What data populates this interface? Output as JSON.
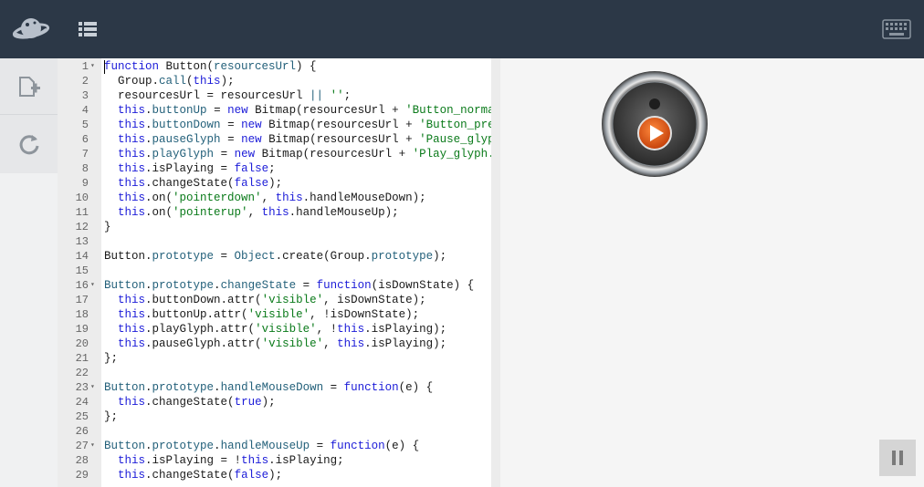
{
  "header": {
    "logo_icon": "planet-icon",
    "menu_icon": "list-icon",
    "keyboard_icon": "keyboard-icon",
    "bg_color": "#2c3847"
  },
  "sidebar": {
    "new_file_icon": "new-file-icon",
    "reload_icon": "refresh-icon"
  },
  "editor": {
    "lines": [
      {
        "n": "1",
        "fold": true,
        "tokens": [
          [
            "kw",
            "function"
          ],
          [
            "t",
            " Button("
          ],
          [
            "prop",
            "resourcesUrl"
          ],
          [
            "t",
            ") {"
          ]
        ]
      },
      {
        "n": "2",
        "fold": false,
        "tokens": [
          [
            "t",
            "  Group."
          ],
          [
            "prop",
            "call"
          ],
          [
            "t",
            "("
          ],
          [
            "kw",
            "this"
          ],
          [
            "t",
            ");"
          ]
        ]
      },
      {
        "n": "3",
        "fold": false,
        "tokens": [
          [
            "t",
            "  resourcesUrl = resourcesUrl "
          ],
          [
            "prop",
            "||"
          ],
          [
            "t",
            " "
          ],
          [
            "str",
            "''"
          ],
          [
            "t",
            ";"
          ]
        ]
      },
      {
        "n": "4",
        "fold": false,
        "tokens": [
          [
            "t",
            "  "
          ],
          [
            "kw",
            "this"
          ],
          [
            "t",
            "."
          ],
          [
            "prop",
            "buttonUp"
          ],
          [
            "t",
            " = "
          ],
          [
            "kw",
            "new"
          ],
          [
            "t",
            " Bitmap(resourcesUrl + "
          ],
          [
            "str",
            "'Button_normal.pr"
          ]
        ]
      },
      {
        "n": "5",
        "fold": false,
        "tokens": [
          [
            "t",
            "  "
          ],
          [
            "kw",
            "this"
          ],
          [
            "t",
            "."
          ],
          [
            "prop",
            "buttonDown"
          ],
          [
            "t",
            " = "
          ],
          [
            "kw",
            "new"
          ],
          [
            "t",
            " Bitmap(resourcesUrl + "
          ],
          [
            "str",
            "'Button_pressed"
          ]
        ]
      },
      {
        "n": "6",
        "fold": false,
        "tokens": [
          [
            "t",
            "  "
          ],
          [
            "kw",
            "this"
          ],
          [
            "t",
            "."
          ],
          [
            "prop",
            "pauseGlyph"
          ],
          [
            "t",
            " = "
          ],
          [
            "kw",
            "new"
          ],
          [
            "t",
            " Bitmap(resourcesUrl + "
          ],
          [
            "str",
            "'Pause_glyph.pr"
          ]
        ]
      },
      {
        "n": "7",
        "fold": false,
        "tokens": [
          [
            "t",
            "  "
          ],
          [
            "kw",
            "this"
          ],
          [
            "t",
            "."
          ],
          [
            "prop",
            "playGlyph"
          ],
          [
            "t",
            " = "
          ],
          [
            "kw",
            "new"
          ],
          [
            "t",
            " Bitmap(resourcesUrl + "
          ],
          [
            "str",
            "'Play_glyph.png'"
          ]
        ]
      },
      {
        "n": "8",
        "fold": false,
        "tokens": [
          [
            "t",
            "  "
          ],
          [
            "kw",
            "this"
          ],
          [
            "t",
            ".isPlaying = "
          ],
          [
            "kw",
            "false"
          ],
          [
            "t",
            ";"
          ]
        ]
      },
      {
        "n": "9",
        "fold": false,
        "tokens": [
          [
            "t",
            "  "
          ],
          [
            "kw",
            "this"
          ],
          [
            "t",
            ".changeState("
          ],
          [
            "kw",
            "false"
          ],
          [
            "t",
            ");"
          ]
        ]
      },
      {
        "n": "10",
        "fold": false,
        "tokens": [
          [
            "t",
            "  "
          ],
          [
            "kw",
            "this"
          ],
          [
            "t",
            ".on("
          ],
          [
            "str",
            "'pointerdown'"
          ],
          [
            "t",
            ", "
          ],
          [
            "kw",
            "this"
          ],
          [
            "t",
            ".handleMouseDown);"
          ]
        ]
      },
      {
        "n": "11",
        "fold": false,
        "tokens": [
          [
            "t",
            "  "
          ],
          [
            "kw",
            "this"
          ],
          [
            "t",
            ".on("
          ],
          [
            "str",
            "'pointerup'"
          ],
          [
            "t",
            ", "
          ],
          [
            "kw",
            "this"
          ],
          [
            "t",
            ".handleMouseUp);"
          ]
        ]
      },
      {
        "n": "12",
        "fold": false,
        "tokens": [
          [
            "t",
            "}"
          ]
        ]
      },
      {
        "n": "13",
        "fold": false,
        "tokens": [
          [
            "t",
            ""
          ]
        ]
      },
      {
        "n": "14",
        "fold": false,
        "tokens": [
          [
            "t",
            "Button."
          ],
          [
            "prop",
            "prototype"
          ],
          [
            "t",
            " = "
          ],
          [
            "prop",
            "Object"
          ],
          [
            "t",
            ".create(Group."
          ],
          [
            "prop",
            "prototype"
          ],
          [
            "t",
            ");"
          ]
        ]
      },
      {
        "n": "15",
        "fold": false,
        "tokens": [
          [
            "t",
            ""
          ]
        ]
      },
      {
        "n": "16",
        "fold": true,
        "tokens": [
          [
            "prop",
            "Button"
          ],
          [
            "t",
            "."
          ],
          [
            "prop",
            "prototype"
          ],
          [
            "t",
            "."
          ],
          [
            "prop",
            "changeState"
          ],
          [
            "t",
            " = "
          ],
          [
            "kw",
            "function"
          ],
          [
            "t",
            "(isDownState) {"
          ]
        ]
      },
      {
        "n": "17",
        "fold": false,
        "tokens": [
          [
            "t",
            "  "
          ],
          [
            "kw",
            "this"
          ],
          [
            "t",
            ".buttonDown.attr("
          ],
          [
            "str",
            "'visible'"
          ],
          [
            "t",
            ", isDownState);"
          ]
        ]
      },
      {
        "n": "18",
        "fold": false,
        "tokens": [
          [
            "t",
            "  "
          ],
          [
            "kw",
            "this"
          ],
          [
            "t",
            ".buttonUp.attr("
          ],
          [
            "str",
            "'visible'"
          ],
          [
            "t",
            ", !isDownState);"
          ]
        ]
      },
      {
        "n": "19",
        "fold": false,
        "tokens": [
          [
            "t",
            "  "
          ],
          [
            "kw",
            "this"
          ],
          [
            "t",
            ".playGlyph.attr("
          ],
          [
            "str",
            "'visible'"
          ],
          [
            "t",
            ", !"
          ],
          [
            "kw",
            "this"
          ],
          [
            "t",
            ".isPlaying);"
          ]
        ]
      },
      {
        "n": "20",
        "fold": false,
        "tokens": [
          [
            "t",
            "  "
          ],
          [
            "kw",
            "this"
          ],
          [
            "t",
            ".pauseGlyph.attr("
          ],
          [
            "str",
            "'visible'"
          ],
          [
            "t",
            ", "
          ],
          [
            "kw",
            "this"
          ],
          [
            "t",
            ".isPlaying);"
          ]
        ]
      },
      {
        "n": "21",
        "fold": false,
        "tokens": [
          [
            "t",
            "};"
          ]
        ]
      },
      {
        "n": "22",
        "fold": false,
        "tokens": [
          [
            "t",
            ""
          ]
        ]
      },
      {
        "n": "23",
        "fold": true,
        "tokens": [
          [
            "prop",
            "Button"
          ],
          [
            "t",
            "."
          ],
          [
            "prop",
            "prototype"
          ],
          [
            "t",
            "."
          ],
          [
            "prop",
            "handleMouseDown"
          ],
          [
            "t",
            " = "
          ],
          [
            "kw",
            "function"
          ],
          [
            "t",
            "(e) {"
          ]
        ]
      },
      {
        "n": "24",
        "fold": false,
        "tokens": [
          [
            "t",
            "  "
          ],
          [
            "kw",
            "this"
          ],
          [
            "t",
            ".changeState("
          ],
          [
            "kw",
            "true"
          ],
          [
            "t",
            ");"
          ]
        ]
      },
      {
        "n": "25",
        "fold": false,
        "tokens": [
          [
            "t",
            "};"
          ]
        ]
      },
      {
        "n": "26",
        "fold": false,
        "tokens": [
          [
            "t",
            ""
          ]
        ]
      },
      {
        "n": "27",
        "fold": true,
        "tokens": [
          [
            "prop",
            "Button"
          ],
          [
            "t",
            "."
          ],
          [
            "prop",
            "prototype"
          ],
          [
            "t",
            "."
          ],
          [
            "prop",
            "handleMouseUp"
          ],
          [
            "t",
            " = "
          ],
          [
            "kw",
            "function"
          ],
          [
            "t",
            "(e) {"
          ]
        ]
      },
      {
        "n": "28",
        "fold": false,
        "tokens": [
          [
            "t",
            "  "
          ],
          [
            "kw",
            "this"
          ],
          [
            "t",
            ".isPlaying = !"
          ],
          [
            "kw",
            "this"
          ],
          [
            "t",
            ".isPlaying;"
          ]
        ]
      },
      {
        "n": "29",
        "fold": false,
        "tokens": [
          [
            "t",
            "  "
          ],
          [
            "kw",
            "this"
          ],
          [
            "t",
            ".changeState("
          ],
          [
            "kw",
            "false"
          ],
          [
            "t",
            ");"
          ]
        ]
      }
    ]
  },
  "preview": {
    "player_icon": "play-button-icon",
    "pause_icon": "pause-icon",
    "accent_color": "#e2520f"
  }
}
